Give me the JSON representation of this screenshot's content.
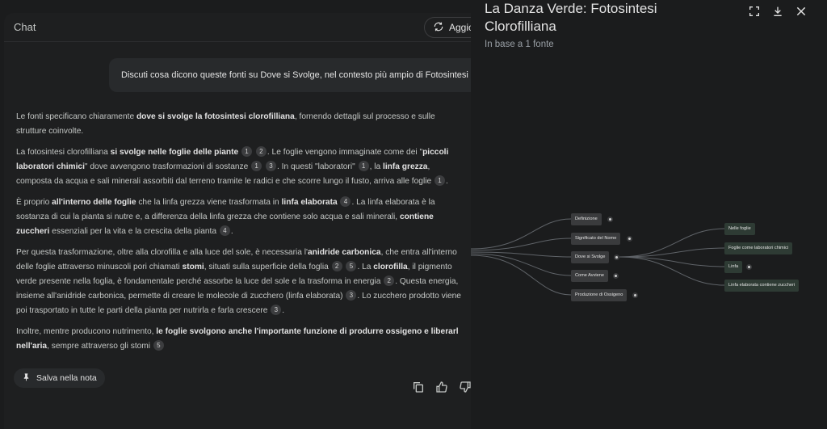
{
  "chat": {
    "title": "Chat",
    "update_label": "Aggio",
    "user_message": "Discuti cosa dicono queste fonti su Dove si Svolge, nel contesto più ampio di Fotosintesi Cloro",
    "answer": {
      "p1": {
        "t1": "Le fonti specificano chiaramente ",
        "b1": "dove si svolge la fotosintesi clorofilliana",
        "t2": ", fornendo dettagli sul processo e sulle",
        "t3": "strutture coinvolte."
      },
      "p2": {
        "t1": "La fotosintesi clorofilliana ",
        "b1": "si svolge nelle foglie delle piante",
        "c1": "1",
        "c2": "2",
        "t2": ". Le foglie vengono immaginate come dei \"",
        "b2": "piccoli",
        "b3": "laboratori chimici",
        "t3": "\" dove avvengono trasformazioni di sostanze",
        "c3": "1",
        "c4": "3",
        "t4": ". In questi \"laboratori\"",
        "c5": "1",
        "t5": ", la ",
        "b4": "linfa grezza",
        "t6": ",",
        "t7": "composta da acqua e sali minerali assorbiti dal terreno tramite le radici e che scorre lungo il fusto, arriva alle foglie",
        "c6": "1",
        "t8": "."
      },
      "p3": {
        "t1": "È proprio ",
        "b1": "all'interno delle foglie",
        "t2": " che la linfa grezza viene trasformata in ",
        "b2": "linfa elaborata",
        "c1": "4",
        "t3": ". La linfa elaborata è la",
        "t4": "sostanza di cui la pianta si nutre e, a differenza della linfa grezza che contiene solo acqua e sali minerali, ",
        "b3": "contiene",
        "b4": "zuccheri",
        "t5": " essenziali per la vita e la crescita della pianta",
        "c2": "4",
        "t6": "."
      },
      "p4": {
        "t1": "Per questa trasformazione, oltre alla clorofilla e alla luce del sole, è necessaria l'",
        "b1": "anidride carbonica",
        "t2": ", che entra all'interno",
        "t3": "delle foglie attraverso minuscoli pori chiamati ",
        "b2": "stomi",
        "t4": ", situati sulla superficie della foglia",
        "c1": "2",
        "c2": "5",
        "t5": ". La ",
        "b3": "clorofilla",
        "t6": ", il pigmento",
        "t7": "verde presente nella foglia, è fondamentale perché assorbe la luce del sole e la trasforma in energia",
        "c3": "2",
        "t8": ". Questa energia,",
        "t9": "insieme all'anidride carbonica, permette di creare le molecole di zucchero (linfa elaborata)",
        "c4": "3",
        "t10": ". Lo zucchero prodotto viene",
        "t11": "poi trasportato in tutte le parti della pianta per nutrirla e farla crescere",
        "c5": "3",
        "t12": "."
      },
      "p5": {
        "t1": "Inoltre, mentre producono nutrimento, ",
        "b1": "le foglie svolgono anche l'importante funzione di produrre ossigeno e liberarl",
        "b2": "nell'aria",
        "t2": ", sempre attraverso gli stomi",
        "c1": "5",
        "t3": ""
      }
    },
    "save_label": "Salva nella nota",
    "icons": {
      "copy": "copy-icon",
      "like": "thumb-up-icon",
      "dislike": "thumb-down-icon",
      "save": "pin-icon",
      "update": "refresh-icon"
    }
  },
  "studio": {
    "title_line1": "La Danza Verde: Fotosintesi",
    "title_line2": "Clorofilliana",
    "subtitle": "In base a 1 fonte",
    "icons": [
      "fullscreen-icon",
      "download-icon",
      "close-icon"
    ]
  },
  "mindmap": {
    "left_nodes": [
      "Definizione",
      "Significato del Nome",
      "Dove si Svolge",
      "Come Avviene",
      "Produzione di Ossigeno"
    ],
    "right_nodes": [
      "Nelle foglie",
      "Foglie come laboratori chimici",
      "Linfa",
      "Linfa elaborata contiene zuccheri"
    ],
    "colors": {
      "node": "#3a3b3d",
      "expanded_child": "#2e3b34",
      "edge": "#5f6368"
    }
  }
}
